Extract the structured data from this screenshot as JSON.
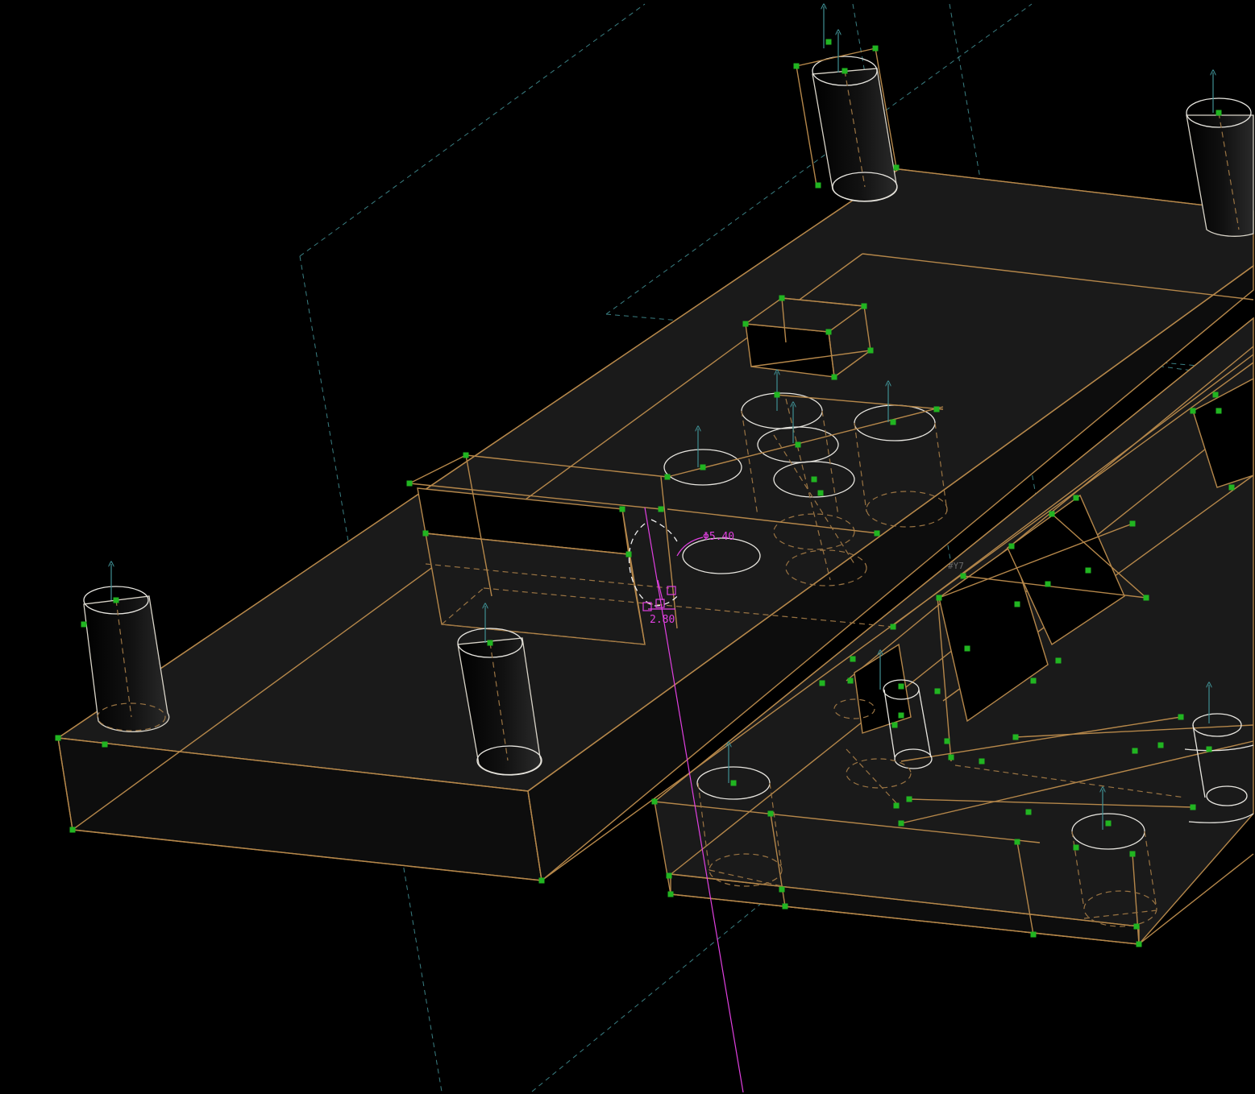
{
  "dimensions": {
    "diameter_label": "Φ5.40",
    "offset_label": "2.80"
  },
  "annotations": {
    "sketch_tag": "#Y7"
  },
  "colors": {
    "background": "#000000",
    "edge": "#b5874a",
    "datum": "#3a7f83",
    "vertex": "#21b521",
    "dimension": "#e040e0",
    "selection": "#f0f0f0"
  },
  "icons": [
    "vertex-marker",
    "normal-arrow-icon"
  ]
}
